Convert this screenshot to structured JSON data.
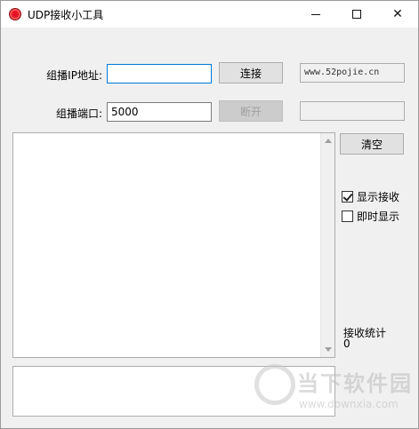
{
  "window": {
    "title": "UDP接收小工具",
    "controls": {
      "minimize": "minimize",
      "maximize": "maximize",
      "close": "✕"
    }
  },
  "form": {
    "ip_label": "组播IP地址:",
    "ip_value": "",
    "connect_label": "连接",
    "url_display": "www.52pojie.cn",
    "port_label": "组播端口:",
    "port_value": "5000",
    "disconnect_label": "断开",
    "extra_display": ""
  },
  "side": {
    "clear_label": "清空",
    "show_recv_label": "显示接收",
    "show_recv_checked": true,
    "instant_show_label": "即时显示",
    "instant_show_checked": false,
    "stats_label": "接收统计",
    "stats_value": "0"
  },
  "bottom": {
    "send_text": "",
    "watermark": "当下软件园",
    "watermark_url": "www.downxia.com"
  },
  "icons": {
    "app": "record-icon",
    "accent": "#0078d7",
    "app_icon_color": "#e81123"
  }
}
